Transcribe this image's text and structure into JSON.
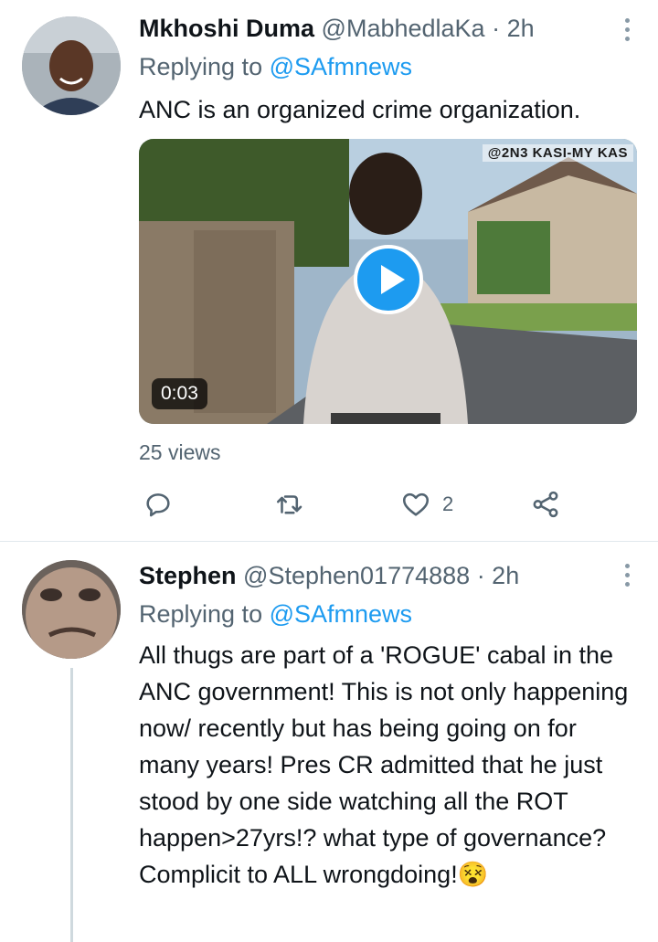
{
  "tweets": [
    {
      "name": "Mkhoshi Duma",
      "handle": "@MabhedlaKa",
      "time": "· 2h",
      "replying_prefix": "Replying to",
      "replying_to": "@SAfmnews",
      "text": "ANC is an organized crime organization.",
      "video": {
        "duration": "0:03",
        "watermark": "@2N3 KASI-MY KAS"
      },
      "views": "25 views",
      "like_count": "2"
    },
    {
      "name": "Stephen",
      "handle": "@Stephen01774888",
      "time": "· 2h",
      "replying_prefix": "Replying to",
      "replying_to": "@SAfmnews",
      "text": "All thugs are part of a 'ROGUE' cabal in the ANC government! This is not only happening now/ recently but has being going on for many years! Pres CR admitted that he just stood by one side watching all the ROT happen>27yrs!? what type of governance? Complicit to ALL wrongdoing!",
      "emoji": "😵"
    }
  ],
  "colors": {
    "link": "#1d9bf0",
    "secondary_text": "#536471",
    "divider": "#e1e8ed"
  },
  "icons": [
    "more-vertical-icon",
    "play-icon",
    "reply-icon",
    "retweet-icon",
    "like-icon",
    "share-icon"
  ]
}
